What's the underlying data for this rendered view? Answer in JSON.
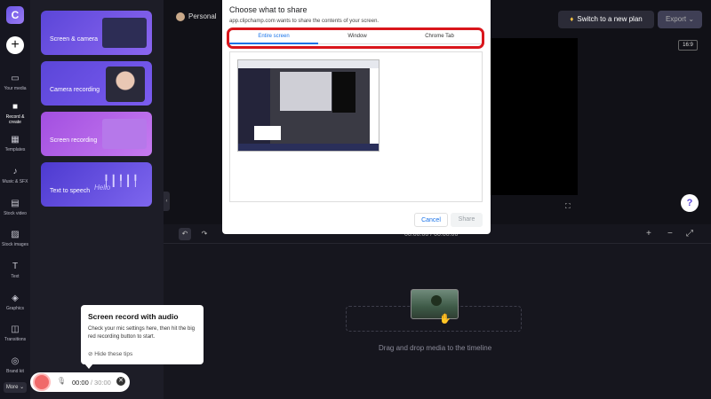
{
  "rail": {
    "logo": "C",
    "add": "+",
    "items": [
      {
        "name": "your-media",
        "icon": "▭",
        "label": "Your media"
      },
      {
        "name": "record-create",
        "icon": "■",
        "label": "Record & create"
      },
      {
        "name": "templates",
        "icon": "▦",
        "label": "Templates"
      },
      {
        "name": "music-sfx",
        "icon": "♪",
        "label": "Music & SFX"
      },
      {
        "name": "stock-video",
        "icon": "▤",
        "label": "Stock video"
      },
      {
        "name": "stock-images",
        "icon": "▨",
        "label": "Stock images"
      },
      {
        "name": "text",
        "icon": "T",
        "label": "Text"
      },
      {
        "name": "graphics",
        "icon": "◈",
        "label": "Graphics"
      },
      {
        "name": "transitions",
        "icon": "◫",
        "label": "Transitions"
      },
      {
        "name": "brand-kit",
        "icon": "◎",
        "label": "Brand kit"
      }
    ],
    "more": "More ⌄"
  },
  "panel": {
    "cards": [
      "Screen & camera",
      "Camera recording",
      "Screen recording",
      "Text to speech"
    ],
    "hello": "Hello"
  },
  "topbar": {
    "workspace": "Personal",
    "upgrade_icon": "♦",
    "upgrade": "Switch to a new plan",
    "export": "Export ⌄",
    "ratio": "16:9"
  },
  "dialog": {
    "title": "Choose what to share",
    "subtitle": "app.clipchamp.com wants to share the contents of your screen.",
    "tabs": [
      "Entire screen",
      "Window",
      "Chrome Tab"
    ],
    "cancel": "Cancel",
    "share": "Share"
  },
  "timeline": {
    "timecode": "00:00.00 / 00:00.00",
    "drop_text": "Drag and drop media to the timeline",
    "undo": "↶",
    "redo": "↷",
    "zoom_in": "+",
    "zoom_out": "−",
    "fit": "⤢",
    "help": "?"
  },
  "tip": {
    "title": "Screen record with audio",
    "body": "Check your mic settings here, then hit the big red recording button to start.",
    "hide": "⊘ Hide these tips"
  },
  "recorder": {
    "mic_icon": "🎙",
    "time": "00:00",
    "sep": " / ",
    "limit": "30:00",
    "close": "✕"
  }
}
